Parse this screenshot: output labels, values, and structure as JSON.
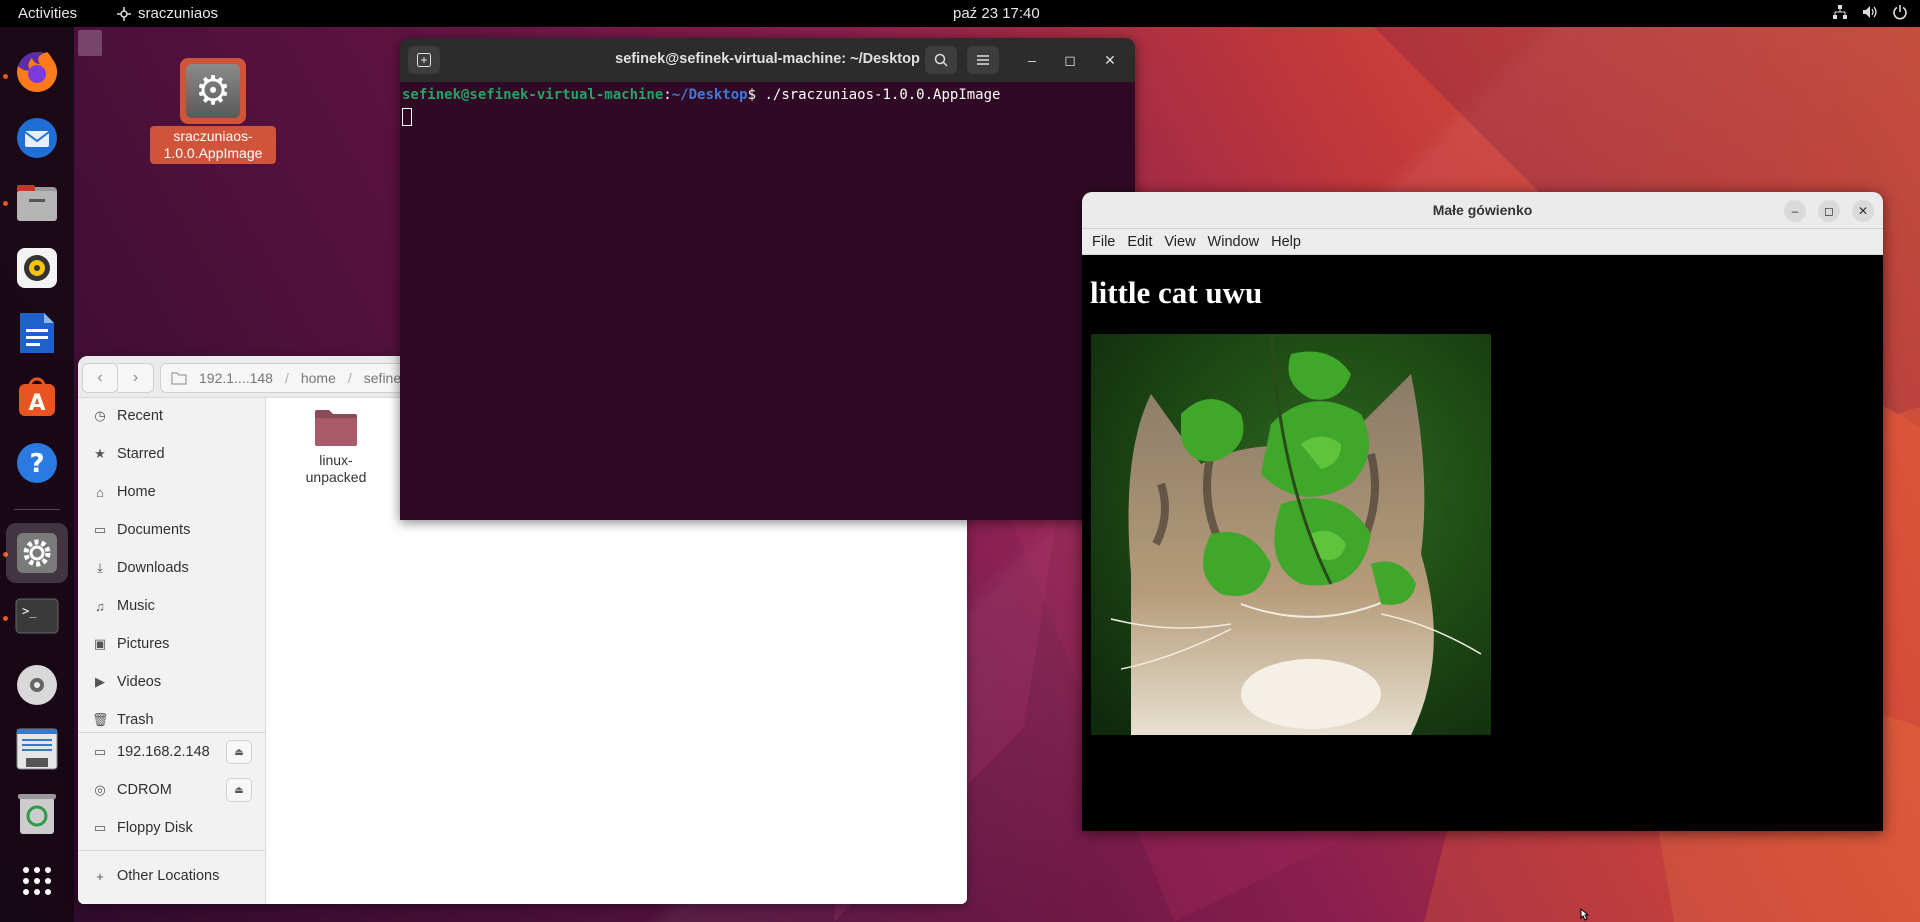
{
  "topbar": {
    "activities": "Activities",
    "app_name": "sraczuniaos",
    "clock": "paź 23  17:40"
  },
  "desktop": {
    "icon_label": "sraczuniaos-1.0.0.AppImage"
  },
  "dock": {
    "apps": [
      "firefox-icon",
      "thunderbird-icon",
      "files-icon",
      "rhythmbox-icon",
      "writer-icon",
      "software-icon",
      "help-icon",
      "settings-icon",
      "terminal-icon",
      "dvd-icon",
      "document-icon",
      "trash-icon",
      "apps-grid-icon"
    ]
  },
  "files": {
    "path": [
      "192.1....148",
      "home",
      "sefinek"
    ],
    "sidebar": [
      {
        "label": "Recent",
        "icon": "clock-icon"
      },
      {
        "label": "Starred",
        "icon": "star-icon"
      },
      {
        "label": "Home",
        "icon": "home-icon"
      },
      {
        "label": "Documents",
        "icon": "document-icon"
      },
      {
        "label": "Downloads",
        "icon": "download-icon"
      },
      {
        "label": "Music",
        "icon": "music-icon"
      },
      {
        "label": "Pictures",
        "icon": "picture-icon"
      },
      {
        "label": "Videos",
        "icon": "video-icon"
      },
      {
        "label": "Trash",
        "icon": "trash-icon"
      }
    ],
    "devices": [
      {
        "label": "192.168.2.148",
        "icon": "folder-icon",
        "eject": true
      },
      {
        "label": "CDROM",
        "icon": "disc-icon",
        "eject": true
      },
      {
        "label": "Floppy Disk",
        "icon": "drive-icon",
        "eject": false
      }
    ],
    "other_locations": "Other Locations",
    "folder_label_line1": "linux-",
    "folder_label_line2": "unpacked"
  },
  "terminal": {
    "title": "sefinek@sefinek-virtual-machine: ~/Desktop",
    "prompt_user": "sefinek@sefinek-virtual-machine",
    "prompt_colon": ":",
    "prompt_path": "~/Desktop",
    "prompt_symbol": "$",
    "command": " ./sraczuniaos-1.0.0.AppImage"
  },
  "app_window": {
    "title": "Małe gówienko",
    "menu": [
      "File",
      "Edit",
      "View",
      "Window",
      "Help"
    ],
    "heading": "little cat uwu"
  }
}
